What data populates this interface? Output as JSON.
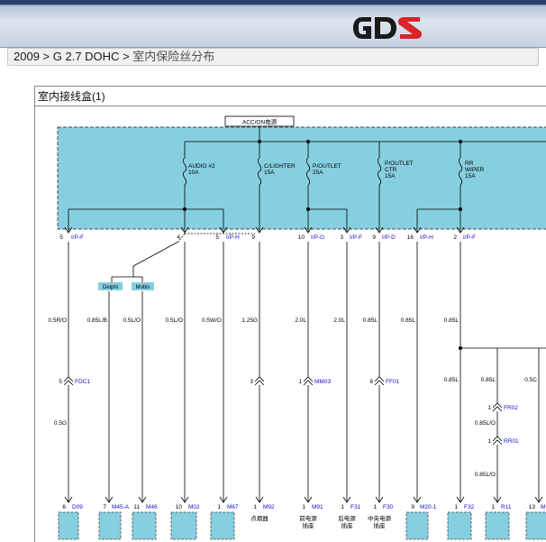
{
  "header": {
    "logo_text": "GDS",
    "logo_colors": {
      "dark": "#1a1a1a",
      "red": "#d8242a"
    }
  },
  "breadcrumb": {
    "year": "2009",
    "separator": ">",
    "model": "G 2.7 DOHC",
    "current": "室内保险丝分布"
  },
  "panel": {
    "title": "室内接线盒(1)"
  },
  "colors": {
    "junction_box": "#86cfe0",
    "link_blue": "#1010c8",
    "wire": "#000000"
  },
  "diagram": {
    "power_label": "ACC/ON电源",
    "fuses": [
      {
        "id": "audio",
        "lines": [
          "AUDIO #2",
          "10A"
        ]
      },
      {
        "id": "cigar",
        "lines": [
          "C/LIGHTER",
          "15A"
        ]
      },
      {
        "id": "outlet",
        "lines": [
          "P/OUTLET",
          "25A"
        ]
      },
      {
        "id": "outlet-ctr",
        "lines": [
          "P/OUTLET",
          "CTR",
          "15A"
        ]
      },
      {
        "id": "wiper",
        "lines": [
          "RR",
          "WIPER",
          "15A"
        ]
      }
    ],
    "top_pins": [
      {
        "num": "5",
        "conn": "I/P-F"
      },
      {
        "num": "4",
        "conn": ""
      },
      {
        "num": "5",
        "conn": "I/P-H"
      },
      {
        "num": "9",
        "conn": ""
      },
      {
        "num": "10",
        "conn": "I/P-G"
      },
      {
        "num": "3",
        "conn": "I/P-F"
      },
      {
        "num": "9",
        "conn": "I/P-D"
      },
      {
        "num": "16",
        "conn": "I/P-H"
      },
      {
        "num": "2",
        "conn": "I/P-F"
      }
    ],
    "variants": [
      "Delphi",
      "Mobis"
    ],
    "wire_codes": [
      "0.5R/O",
      "0.85L/B",
      "0.5L/O",
      "0.5L/O",
      "0.5W/O",
      "1.25G",
      "2.0L",
      "2.0L",
      "0.85L",
      "0.85L",
      "0.85L"
    ],
    "wire_codes_lower": {
      "g1": "0.5G",
      "w12a": "0.85L",
      "w12b": "0.85L",
      "w13": "0.5C",
      "w14": "0.85L/O",
      "w15": "0.85L/O"
    },
    "splices": [
      {
        "num": "5",
        "conn": "FDC1"
      },
      {
        "num": "3",
        "conn": ""
      },
      {
        "num": "1",
        "conn": "MM03"
      },
      {
        "num": "8",
        "conn": "FF01"
      },
      {
        "num": "1",
        "conn": "FR02"
      },
      {
        "num": "1",
        "conn": "RR01"
      }
    ],
    "bottom_pins": [
      {
        "num": "6",
        "conn": "D09"
      },
      {
        "num": "7",
        "conn": "M45-A"
      },
      {
        "num": "11",
        "conn": "M46"
      },
      {
        "num": "10",
        "conn": "M02"
      },
      {
        "num": "1",
        "conn": "M67"
      },
      {
        "num": "1",
        "conn": "M92"
      },
      {
        "num": "1",
        "conn": "M91"
      },
      {
        "num": "1",
        "conn": "F31"
      },
      {
        "num": "1",
        "conn": "F30"
      },
      {
        "num": "9",
        "conn": "M20-1"
      },
      {
        "num": "1",
        "conn": "F32"
      },
      {
        "num": "1",
        "conn": "R11"
      },
      {
        "num": "13",
        "conn": "M"
      }
    ],
    "devices": [
      {
        "lines": [
          "点烟器"
        ]
      },
      {
        "lines": [
          "前电源",
          "插座"
        ]
      },
      {
        "lines": [
          "后电源",
          "插座"
        ]
      },
      {
        "lines": [
          "中央电源",
          "插座"
        ]
      }
    ]
  }
}
